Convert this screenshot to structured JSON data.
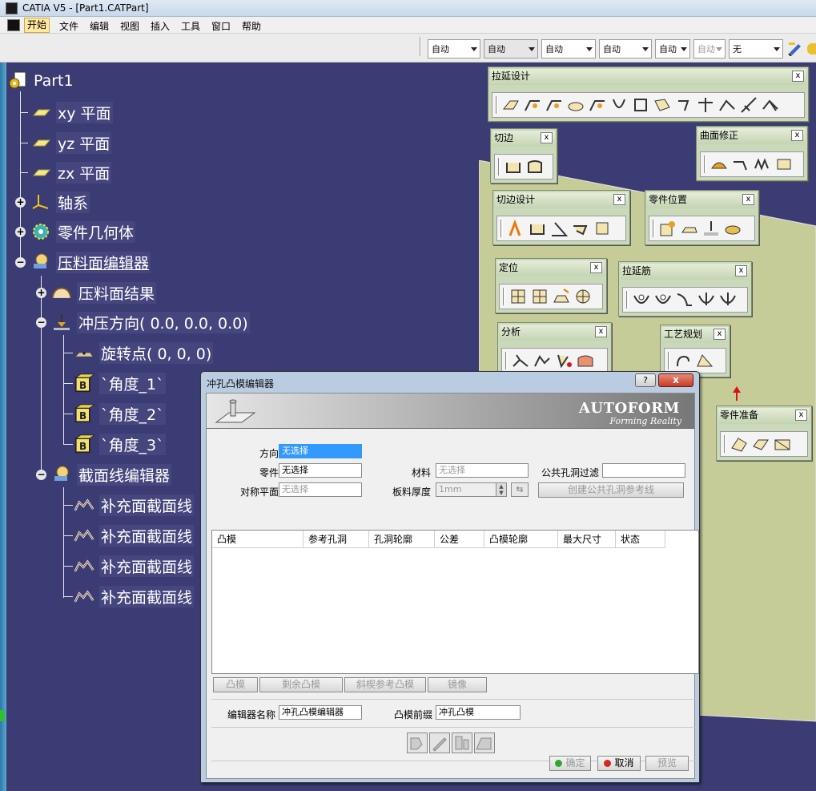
{
  "window": {
    "title": "CATIA V5 - [Part1.CATPart]"
  },
  "menu": [
    "开始",
    "文件",
    "编辑",
    "视图",
    "插入",
    "工具",
    "窗口",
    "帮助"
  ],
  "toolbar_combos": [
    {
      "value": "自动",
      "state": "normal"
    },
    {
      "value": "自动",
      "state": "selected"
    },
    {
      "value": "自动",
      "state": "normal"
    },
    {
      "value": "自动",
      "state": "normal"
    },
    {
      "value": "自动",
      "state": "normal"
    },
    {
      "value": "自动",
      "state": "disabled"
    },
    {
      "value": "无",
      "state": "normal"
    }
  ],
  "tree": {
    "root": "Part1",
    "nodes": [
      {
        "label": "xy 平面",
        "icon": "plane-icon"
      },
      {
        "label": "yz 平面",
        "icon": "plane-icon"
      },
      {
        "label": "zx 平面",
        "icon": "plane-icon"
      },
      {
        "label": "轴系",
        "icon": "axis-system-icon"
      },
      {
        "label": "零件几何体",
        "icon": "part-body-icon"
      },
      {
        "label": "压料面编辑器",
        "icon": "binder-editor-icon"
      },
      {
        "label": "压料面结果",
        "icon": "binder-result-icon"
      },
      {
        "label": "冲压方向(  0.0,  0.0,  0.0)",
        "icon": "stamping-direction-icon"
      },
      {
        "label": "旋转点(   0,   0,   0)",
        "icon": "rotation-point-icon"
      },
      {
        "label": "`角度_1`",
        "icon": "angle-parameter-icon"
      },
      {
        "label": "`角度_2`",
        "icon": "angle-parameter-icon"
      },
      {
        "label": "`角度_3`",
        "icon": "angle-parameter-icon"
      },
      {
        "label": "截面线编辑器",
        "icon": "section-editor-icon"
      },
      {
        "label": "补充面截面线",
        "icon": "addendum-section-icon"
      },
      {
        "label": "补充面截面线",
        "icon": "addendum-section-icon"
      },
      {
        "label": "补充面截面线",
        "icon": "addendum-section-icon"
      },
      {
        "label": "补充面截面线",
        "icon": "addendum-section-icon"
      }
    ]
  },
  "toolbars": [
    {
      "title": "拉延设计",
      "close": "x",
      "icons": 13
    },
    {
      "title": "切边",
      "close": "x",
      "icons": 2
    },
    {
      "title": "曲面修正",
      "close": "x",
      "icons": 4
    },
    {
      "title": "切边设计",
      "close": "x",
      "icons": 5
    },
    {
      "title": "零件位置",
      "close": "x",
      "icons": 4
    },
    {
      "title": "定位",
      "close": "x",
      "icons": 4
    },
    {
      "title": "拉延筋",
      "close": "x",
      "icons": 5
    },
    {
      "title": "分析",
      "close": "x",
      "icons": 4
    },
    {
      "title": "工艺规划",
      "close": "x",
      "icons": 2
    },
    {
      "title": "零件准备",
      "close": "x",
      "icons": 3
    }
  ],
  "dialog": {
    "title": "冲孔凸模编辑器",
    "help": "?",
    "close": "x",
    "logo": "AUTOFORM",
    "slogan": "Forming Reality",
    "fields": {
      "direction_label": "方向",
      "direction_value": "无选择",
      "part_label": "零件",
      "part_value": "无选择",
      "material_label": "材料",
      "material_value": "无选择",
      "common_filter_label": "公共孔洞过滤",
      "common_filter_value": "",
      "symmetry_label": "对称平面",
      "symmetry_value": "无选择",
      "thickness_label": "板料厚度",
      "thickness_value": "1mm",
      "create_button": "创建公共孔洞参考线"
    },
    "table_headers": [
      "凸模",
      "参考孔洞",
      "孔洞轮廓",
      "公差",
      "凸模轮廓",
      "最大尺寸",
      "状态"
    ],
    "table_buttons": [
      "凸模",
      "剩余凸模",
      "斜楔参考凸模",
      "镜像"
    ],
    "editor_name_label": "编辑器名称",
    "editor_name_value": "冲孔凸模编辑器",
    "prefix_label": "凸模前缀",
    "prefix_value": "冲孔凸模",
    "ok": "确定",
    "cancel": "取消",
    "preview": "预览",
    "ok_color": "#2ea82e",
    "cancel_color": "#d42a1e"
  }
}
